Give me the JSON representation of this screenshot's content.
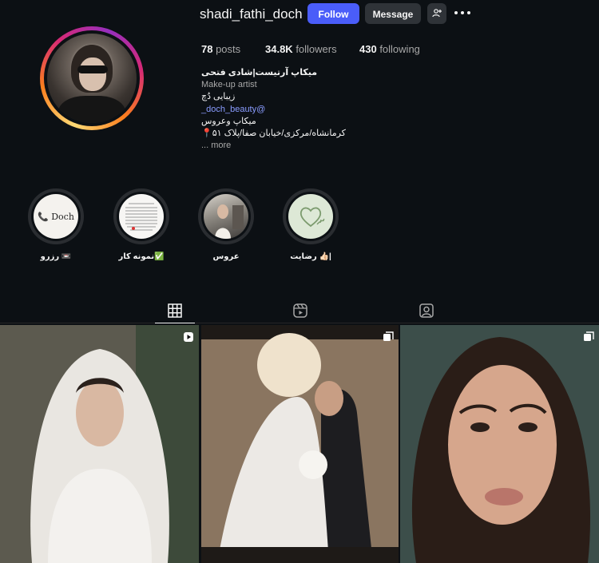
{
  "profile": {
    "username": "shadi_fathi_doch",
    "follow_label": "Follow",
    "message_label": "Message",
    "stats": {
      "posts_value": "78",
      "posts_label": " posts",
      "followers_value": "34.8K",
      "followers_label": " followers",
      "following_value": "430",
      "following_label": " following"
    },
    "bio": {
      "name": "میکاپ آرتیست|شادی فتحی",
      "category": "Make-up artist",
      "line1": "زیبایی دُچ",
      "link": "_doch_beauty@",
      "line2": "میکاپ وعروس",
      "line3": "📍کرمانشاه/مرکزی/خیابان صفا/پلاک ۵۱",
      "more": "... more"
    }
  },
  "highlights": [
    {
      "label": "رزرو 📼",
      "cover_text": "📞 Doch"
    },
    {
      "label": "نمونه کار✅",
      "cover_text": ""
    },
    {
      "label": "عروس",
      "cover_text": ""
    },
    {
      "label": "رضایت 👍🏻|",
      "cover_text": ""
    }
  ],
  "tabs": [
    "posts-grid",
    "reels",
    "tagged"
  ],
  "posts": [
    {
      "type": "reel",
      "icon": "reel-badge-icon"
    },
    {
      "type": "carousel",
      "icon": "carousel-badge-icon"
    },
    {
      "type": "carousel",
      "icon": "carousel-badge-icon"
    }
  ],
  "colors": {
    "background": "#0c1014",
    "accent": "#4a5df9",
    "link": "#8a9cff",
    "muted": "#a8a8a8"
  }
}
